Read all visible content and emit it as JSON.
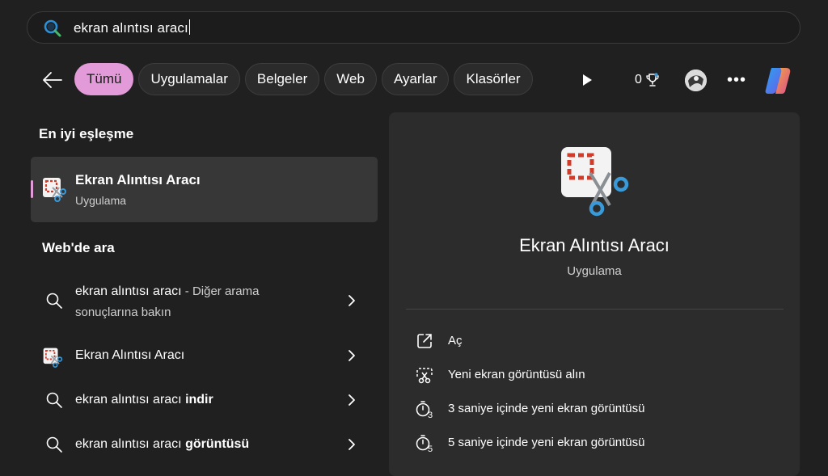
{
  "search": {
    "query": "ekran alıntısı aracı"
  },
  "filters": [
    "Tümü",
    "Uygulamalar",
    "Belgeler",
    "Web",
    "Ayarlar",
    "Klasörler"
  ],
  "toolbar": {
    "points": "0"
  },
  "best_match": {
    "heading": "En iyi eşleşme",
    "title": "Ekran Alıntısı Aracı",
    "subtitle": "Uygulama"
  },
  "web": {
    "heading": "Web'de ara",
    "first": {
      "query": "ekran alıntısı aracı",
      "suffix": " - Diğer arama",
      "line2": "sonuçlarına bakın"
    },
    "app_row": "Ekran Alıntısı Aracı",
    "sugg1": {
      "base": "ekran alıntısı aracı ",
      "bold": "indir"
    },
    "sugg2": {
      "base": "ekran alıntısı aracı ",
      "bold": "görüntüsü"
    }
  },
  "detail": {
    "title": "Ekran Alıntısı Aracı",
    "subtitle": "Uygulama",
    "actions": [
      {
        "icon": "open-icon",
        "label": "Aç"
      },
      {
        "icon": "snip-icon",
        "label": "Yeni ekran görüntüsü alın"
      },
      {
        "icon": "timer-3-icon",
        "label": "3 saniye içinde yeni ekran görüntüsü"
      },
      {
        "icon": "timer-5-icon",
        "label": "5 saniye içinde yeni ekran görüntüsü"
      }
    ]
  },
  "colors": {
    "accent": "#e29ad9",
    "background": "#202020",
    "panel": "#2c2c2c",
    "scissor": "#3a9ad8"
  }
}
